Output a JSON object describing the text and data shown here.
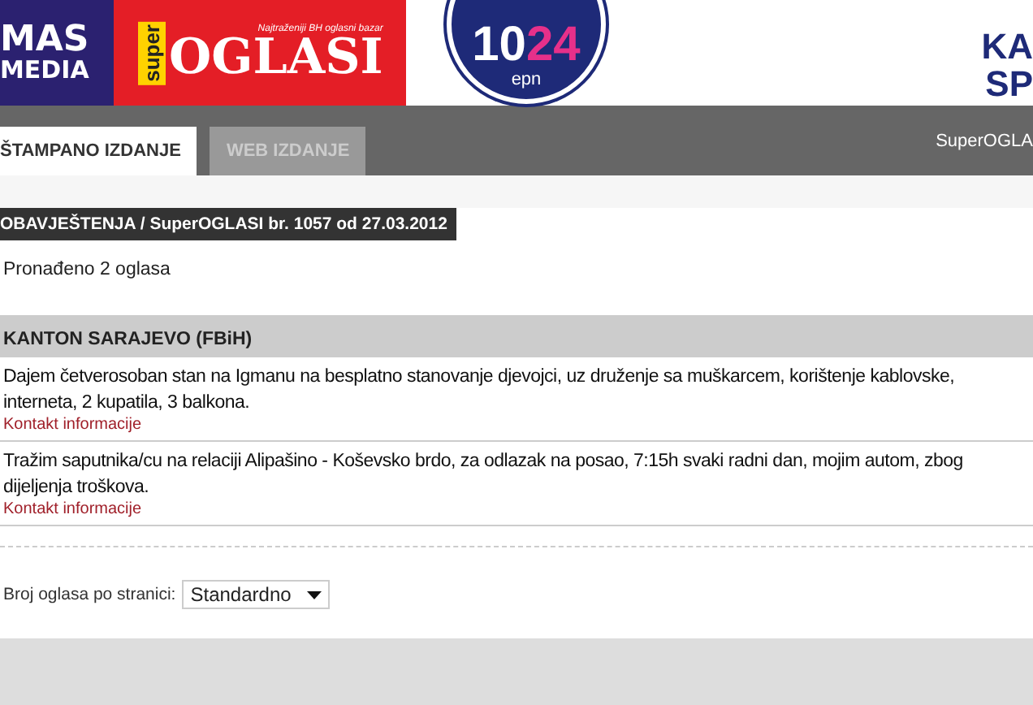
{
  "header": {
    "logos": [
      {
        "kind": "masmedia",
        "lines": [
          "MAS",
          "MEDIA"
        ]
      },
      {
        "kind": "superoglasi",
        "small": "super",
        "big": "OGLASI",
        "tagline": "Najtraženiji BH oglasni bazar"
      },
      {
        "kind": "epn",
        "number_a": "10",
        "number_b": "24",
        "sub": "epn"
      },
      {
        "kind": "partial",
        "lines": [
          "KA",
          "SP"
        ]
      }
    ]
  },
  "tabs": [
    {
      "label": "ŠTAMPANO IZDANJE",
      "selected": true
    },
    {
      "label": "WEB IZDANJE",
      "selected": false
    }
  ],
  "nav_right": "SuperOGLA",
  "breadcrumb": "OBAVJEŠTENJA / SuperOGLASI br. 1057 od 27.03.2012",
  "result_count": "Pronađeno 2 oglasa",
  "section": {
    "title": "KANTON SARAJEVO (FBiH)",
    "ads": [
      {
        "text": "Dajem četverosoban stan na Igmanu na besplatno stanovanje djevojci, uz druženje sa muškarcem, korištenje kablovske, interneta, 2 kupatila, 3 balkona.",
        "link": "Kontakt informacije"
      },
      {
        "text": "Tražim saputnika/cu na relaciji Alipašino - Koševsko brdo, za odlazak na posao, 7:15h svaki radni dan, mojim autom, zbog dijeljenja troškova.",
        "link": "Kontakt informacije"
      }
    ]
  },
  "per_page": {
    "label": "Broj oglasa po stranici:",
    "value": "Standardno"
  }
}
